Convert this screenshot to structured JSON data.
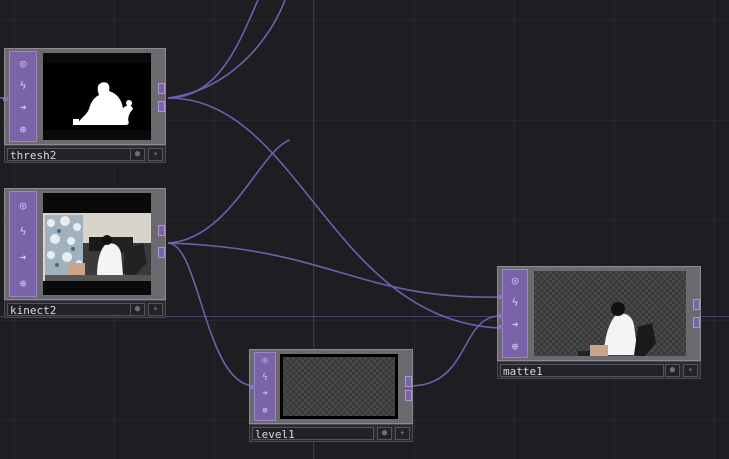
{
  "nodes": {
    "thresh2": {
      "label": "thresh2"
    },
    "kinect2": {
      "label": "kinect2"
    },
    "level1": {
      "label": "level1"
    },
    "matte1": {
      "label": "matte1"
    }
  },
  "icons": {
    "viewer": "target-icon",
    "bypass": "lightning-icon",
    "cook": "arrow-right-icon",
    "lock": "lock-icon",
    "display_flag": "circle-flag-icon",
    "render_flag": "cross-flag-icon"
  },
  "colors": {
    "background": "#1d1d22",
    "node_accent": "#7a63a8",
    "wire": "#6f5fb0"
  }
}
